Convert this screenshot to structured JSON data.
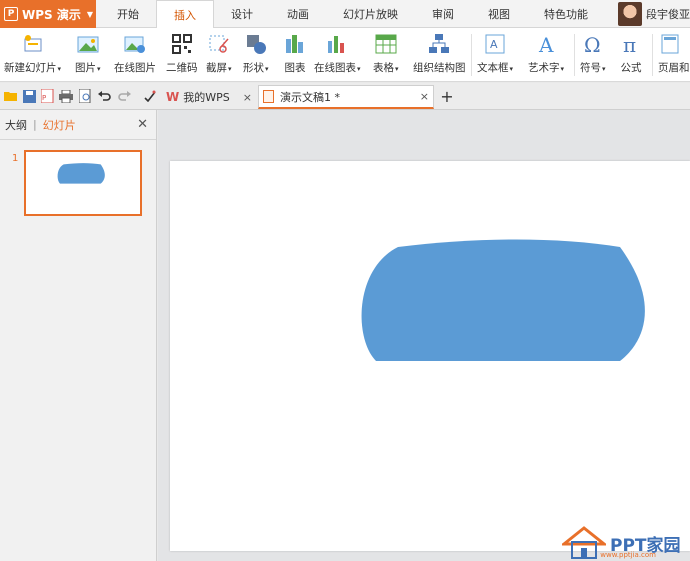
{
  "app": {
    "name": "WPS 演示",
    "logo": "P"
  },
  "tabs": [
    "开始",
    "插入",
    "设计",
    "动画",
    "幻灯片放映",
    "审阅",
    "视图",
    "特色功能"
  ],
  "active_tab": "插入",
  "user": {
    "name": "段宇俊亚"
  },
  "ribbon": {
    "new_slide": "新建幻灯片",
    "picture": "图片",
    "online_picture": "在线图片",
    "qrcode": "二维码",
    "screenshot": "截屏",
    "shapes": "形状",
    "chart": "图表",
    "online_chart": "在线图表",
    "table": "表格",
    "org_chart": "组织结构图",
    "textbox": "文本框",
    "wordart": "艺术字",
    "symbol": "符号",
    "formula": "公式",
    "header_footer": "页眉和"
  },
  "doc_tabs": [
    {
      "label": "我的WPS",
      "close": "×"
    },
    {
      "label": "演示文稿1 *",
      "close": "×"
    }
  ],
  "new_tab": "+",
  "left_panel": {
    "outline": "大纲",
    "divider": "|",
    "slides": "幻灯片",
    "close": "✕"
  },
  "slides": [
    {
      "number": "1"
    }
  ],
  "colors": {
    "accent": "#e8702a",
    "shape_fill": "#5b9bd5"
  },
  "watermark": {
    "text": "PPT家园",
    "sub": "www.pptjia.com"
  }
}
